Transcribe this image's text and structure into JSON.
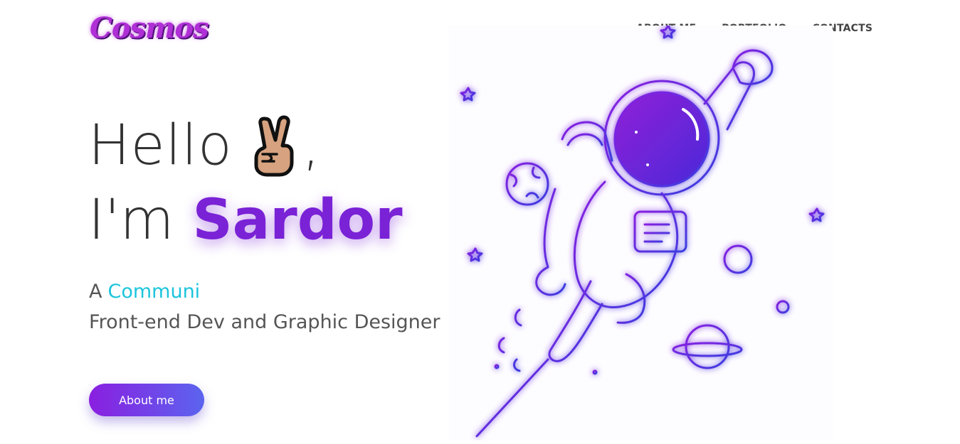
{
  "header": {
    "logo": "Cosmos",
    "nav": [
      "ABOUT ME",
      "PORTFOLIO",
      "CONTACTS"
    ]
  },
  "hero": {
    "hello": "Hello",
    "comma": ",",
    "im": "I'm",
    "name": "Sardor",
    "role_prefix": "A",
    "role_typed": "Communi",
    "role_line2": "Front-end Dev and Graphic Designer",
    "cta_label": "About me",
    "hand_icon": "victory-hand-icon"
  },
  "illustration": {
    "subject": "astronaut-flying-icon"
  },
  "colors": {
    "accent_purple": "#7a22d6",
    "accent_cyan": "#1cc4dc",
    "button_gradient_start": "#8a1fe0",
    "button_gradient_end": "#5b64ef",
    "text_dark": "#333333"
  }
}
